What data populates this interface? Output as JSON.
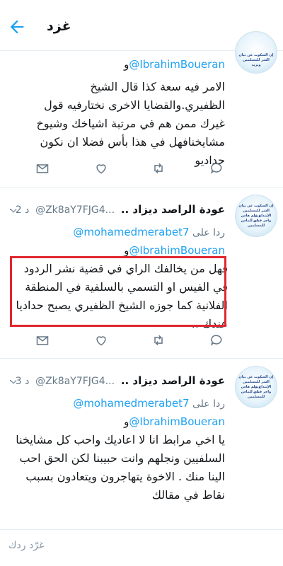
{
  "header": {
    "title": "غزد",
    "back_icon": "arrow-left-icon"
  },
  "tweets": [
    {
      "mention": "@IbrahimBoueran",
      "mention_prefix": "و",
      "body": "الامر فيه سعة كذا قال الشيخ الظفيري.والقضايا الاخرى نختارفيه قول غيرك ممن هم في مرتبة اشياخك وشيوخ مشايخنافهل في هذا بأس فضلا ان نكون حداديو"
    },
    {
      "name": "عودة الراصد ديزاد ..",
      "handle": "@Zk8aY7FJG4...",
      "time": "د 2 ·",
      "reply_to_label": "ردا على",
      "reply_to": "@mohamedmerabet7",
      "mention": "@IbrahimBoueran",
      "mention_prefix": "و",
      "body": "فهل من يخالفك الراي في  قضية نشر الردود في الفيس او التسمي بالسلفية في المنطقة الفلانية كما جوزه الشيخ الظفيري يصبح حداديا عندك .."
    },
    {
      "name": "عودة الراصد ديزاد ..",
      "handle": "@Zk8aY7FJG4...",
      "time": "د 3 ·",
      "reply_to_label": "ردا على",
      "reply_to": "@mohamedmerabet7",
      "mention": "@IbrahimBoueran",
      "mention_prefix": "و",
      "body": "يا اخي مرابط انا لا اعاديك واحب كل مشايخنا السلفيين ونجلهم وانت حبيبنا لكن الحق احب الينا منك . الاخوة يتهاجرون ويتعادون بسبب نقاط في مقالك"
    }
  ],
  "avatar_text": [
    "إن السكوت عن بيان",
    "الشر للمسلمين وبريد",
    "الإبتداع علم هاس عن",
    "واجر فيان للماس",
    "للمسلمين"
  ],
  "reply_placeholder": "غرّد ردك",
  "colors": {
    "accent": "#1da1f2",
    "highlight": "#e0262f"
  }
}
